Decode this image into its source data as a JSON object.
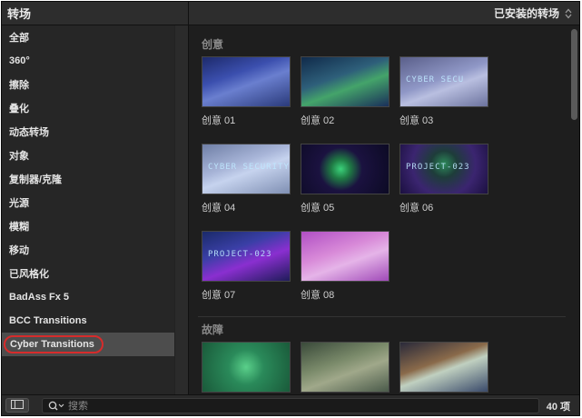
{
  "sidebar": {
    "header": "转场",
    "items": [
      {
        "label": "全部"
      },
      {
        "label": "360°"
      },
      {
        "label": "擦除"
      },
      {
        "label": "叠化"
      },
      {
        "label": "动态转场"
      },
      {
        "label": "对象"
      },
      {
        "label": "复制器/克隆"
      },
      {
        "label": "光源"
      },
      {
        "label": "模糊"
      },
      {
        "label": "移动"
      },
      {
        "label": "已风格化"
      },
      {
        "label": "BadAss Fx 5"
      },
      {
        "label": "BCC Transitions"
      },
      {
        "label": "Cyber Transitions",
        "selected": true
      }
    ]
  },
  "browser": {
    "filter_label": "已安装的转场",
    "sections": [
      {
        "title": "创意",
        "items": [
          {
            "label": "创意 01",
            "overlay": ""
          },
          {
            "label": "创意 02",
            "overlay": ""
          },
          {
            "label": "创意 03",
            "overlay": "CYBER SECU"
          },
          {
            "label": "创意 04",
            "overlay": "CYBER SECURITY"
          },
          {
            "label": "创意 05",
            "overlay": ""
          },
          {
            "label": "创意 06",
            "overlay": "PROJECT-023"
          },
          {
            "label": "创意 07",
            "overlay": "PROJECT-023"
          },
          {
            "label": "创意 08",
            "overlay": ""
          }
        ]
      },
      {
        "title": "故障",
        "items": [
          {
            "label": "",
            "overlay": ""
          },
          {
            "label": "",
            "overlay": ""
          },
          {
            "label": "",
            "overlay": ""
          }
        ]
      }
    ]
  },
  "search": {
    "placeholder": "搜索",
    "value": ""
  },
  "status": {
    "count": "40 项"
  },
  "colors": {
    "selection_ring": "#d62b2b",
    "panel_bg": "#1e1e1e",
    "selected_row": "#4d4d4d"
  }
}
